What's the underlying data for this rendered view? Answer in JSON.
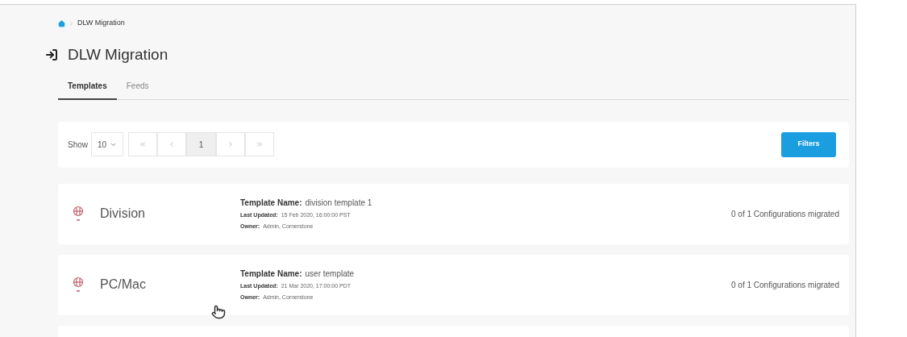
{
  "breadcrumb": {
    "current": "DLW Migration"
  },
  "page_title": "DLW Migration",
  "tabs": [
    {
      "label": "Templates",
      "selected": true
    },
    {
      "label": "Feeds",
      "selected": false
    }
  ],
  "toolbar": {
    "show_label": "Show",
    "page_size": "10",
    "pages": [
      {
        "label": "1",
        "selected": true
      }
    ],
    "filters_button": "Filters"
  },
  "templates": [
    {
      "name": "Division",
      "template_name_label": "Template Name:",
      "template_name": "division template 1",
      "last_updated_label": "Last Updated:",
      "last_updated": "15 Feb 2020, 16:00:00 PST",
      "owner_label": "Owner:",
      "owner": "Admin, Cornerstone",
      "status": "0 of 1 Configurations migrated"
    },
    {
      "name": "PC/Mac",
      "template_name_label": "Template Name:",
      "template_name": "user template",
      "last_updated_label": "Last Updated:",
      "last_updated": "21 Mar 2020, 17:00:00 PDT",
      "owner_label": "Owner:",
      "owner": "Admin, Cornerstone",
      "status": "0 of 1 Configurations migrated"
    }
  ]
}
